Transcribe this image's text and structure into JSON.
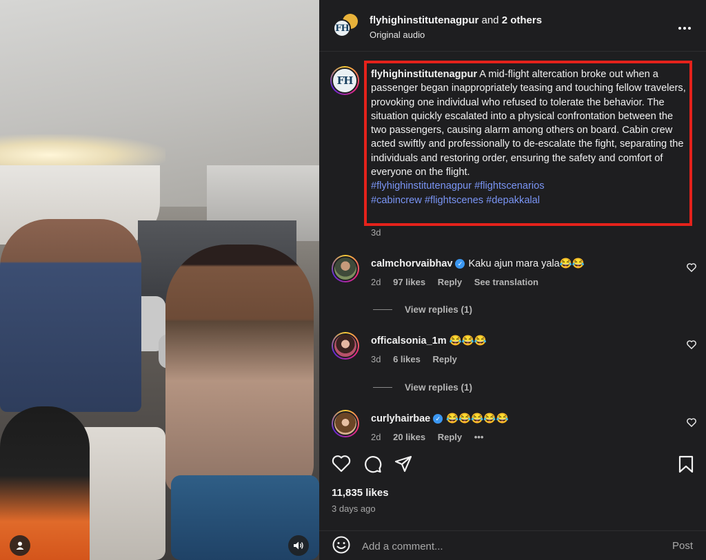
{
  "header": {
    "username": "flyhighinstitutenagpur",
    "and_text": " and ",
    "others": "2 others",
    "subtitle": "Original audio",
    "more_icon": "more-horizontal-icon"
  },
  "logo_text": "FH",
  "caption": {
    "username": "flyhighinstitutenagpur",
    "text": "A mid-flight altercation broke out when a passenger began inappropriately teasing and touching fellow travelers, provoking one individual who refused to tolerate the behavior. The situation quickly escalated into a physical confrontation between the two passengers, causing alarm among others on board. Cabin crew acted swiftly and professionally to de-escalate the fight, separating the individuals and restoring order, ensuring the safety and comfort of everyone on the flight.",
    "hashtags": [
      "#flyhighinstitutenagpur",
      "#flightscenarios",
      "#cabincrew",
      "#flightscenes",
      "#depakkalal"
    ],
    "time": "3d",
    "highlight_color": "#e5221b"
  },
  "comments": [
    {
      "username": "calmchorvaibhav",
      "verified": true,
      "text": "Kaku ajun mara yala😂😂",
      "time": "2d",
      "likes": "97 likes",
      "reply_label": "Reply",
      "extra": "See translation",
      "view_replies": "View replies (1)"
    },
    {
      "username": "officalsonia_1m",
      "verified": false,
      "text": "😂😂😂",
      "time": "3d",
      "likes": "6 likes",
      "reply_label": "Reply",
      "view_replies": "View replies (1)"
    },
    {
      "username": "curlyhairbae",
      "verified": true,
      "text": "😂😂😂😂😂",
      "time": "2d",
      "likes": "20 likes",
      "reply_label": "Reply",
      "extra": "•••"
    }
  ],
  "actions": {
    "like_icon": "heart-icon",
    "comment_icon": "comment-icon",
    "share_icon": "share-icon",
    "save_icon": "bookmark-icon"
  },
  "likes_count": "11,835 likes",
  "post_time": "3 days ago",
  "comment_input": {
    "placeholder": "Add a comment...",
    "post_label": "Post"
  },
  "colors": {
    "background": "#1e1e20",
    "hashtag": "#7a95f5",
    "verified": "#3b97f1",
    "muted": "#a8a8a8"
  }
}
